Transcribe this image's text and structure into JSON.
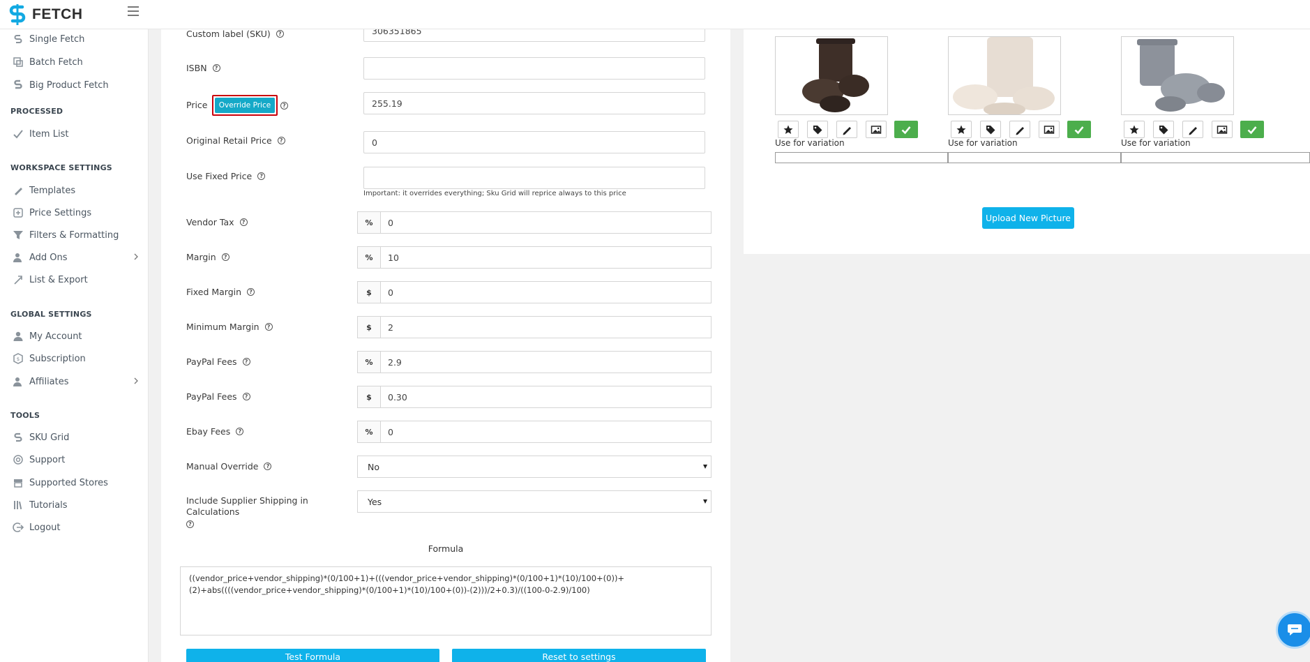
{
  "brand": {
    "name": "FETCH"
  },
  "sidebar": {
    "items_top": [
      {
        "label": "Single Fetch",
        "icon": "single-fetch-icon"
      },
      {
        "label": "Batch Fetch",
        "icon": "batch-fetch-icon"
      },
      {
        "label": "Big Product Fetch",
        "icon": "big-product-fetch-icon"
      }
    ],
    "sections": [
      {
        "title": "PROCESSED",
        "items": [
          {
            "label": "Item List"
          }
        ]
      },
      {
        "title": "WORKSPACE SETTINGS",
        "items": [
          {
            "label": "Templates"
          },
          {
            "label": "Price Settings"
          },
          {
            "label": "Filters & Formatting"
          },
          {
            "label": "Add Ons"
          },
          {
            "label": "List & Export"
          }
        ]
      },
      {
        "title": "GLOBAL SETTINGS",
        "items": [
          {
            "label": "My Account"
          },
          {
            "label": "Subscription"
          },
          {
            "label": "Affiliates"
          }
        ]
      },
      {
        "title": "TOOLS",
        "items": [
          {
            "label": "SKU Grid"
          },
          {
            "label": "Support"
          },
          {
            "label": "Supported Stores"
          },
          {
            "label": "Tutorials"
          },
          {
            "label": "Logout"
          }
        ]
      }
    ]
  },
  "form": {
    "custom_label": {
      "label": "Custom label (SKU)",
      "value": "306351865"
    },
    "isbn": {
      "label": "ISBN",
      "value": ""
    },
    "price": {
      "label": "Price",
      "button": "Override Price",
      "value": "255.19"
    },
    "original_retail": {
      "label": "Original Retail Price",
      "value": "0"
    },
    "fixed_price": {
      "label": "Use Fixed Price",
      "value": "",
      "note": "Important: it overrides everything; Sku Grid will reprice always to this price"
    },
    "vendor_tax": {
      "label": "Vendor Tax",
      "unit": "%",
      "value": "0"
    },
    "margin": {
      "label": "Margin",
      "unit": "%",
      "value": "10"
    },
    "fixed_margin": {
      "label": "Fixed Margin",
      "unit": "$",
      "value": "0"
    },
    "minimum_margin": {
      "label": "Minimum Margin",
      "unit": "$",
      "value": "2"
    },
    "paypal_pct": {
      "label": "PayPal Fees",
      "unit": "%",
      "value": "2.9"
    },
    "paypal_fixed": {
      "label": "PayPal Fees",
      "unit": "$",
      "value": "0.30"
    },
    "ebay_fees": {
      "label": "Ebay Fees",
      "unit": "%",
      "value": "0"
    },
    "manual_override": {
      "label": "Manual Override",
      "value": "No"
    },
    "supplier_shipping": {
      "label": "Include Supplier Shipping in Calculations",
      "value": "Yes"
    },
    "formula_title": "Formula",
    "formula_line1": "((vendor_price+vendor_shipping)*(0/100+1)+(((vendor_price+vendor_shipping)*(0/100+1)*(10)/100+(0))+",
    "formula_line2": "(2)+abs((((vendor_price+vendor_shipping)*(0/100+1)*(10)/100+(0))-(2)))/2+0.3)/((100-0-2.9)/100)",
    "test_button": "Test Formula",
    "reset_button": "Reset to settings"
  },
  "images": {
    "variation_label": "Use for variation",
    "upload_button": "Upload New Picture",
    "colors": [
      "#3e2f28",
      "#e7ddd3",
      "#8d929b"
    ]
  },
  "colors": {
    "accent": "#0fb2ea",
    "ok": "#4cae4c",
    "override": "#15a9c8",
    "highlight": "#c9000b"
  }
}
